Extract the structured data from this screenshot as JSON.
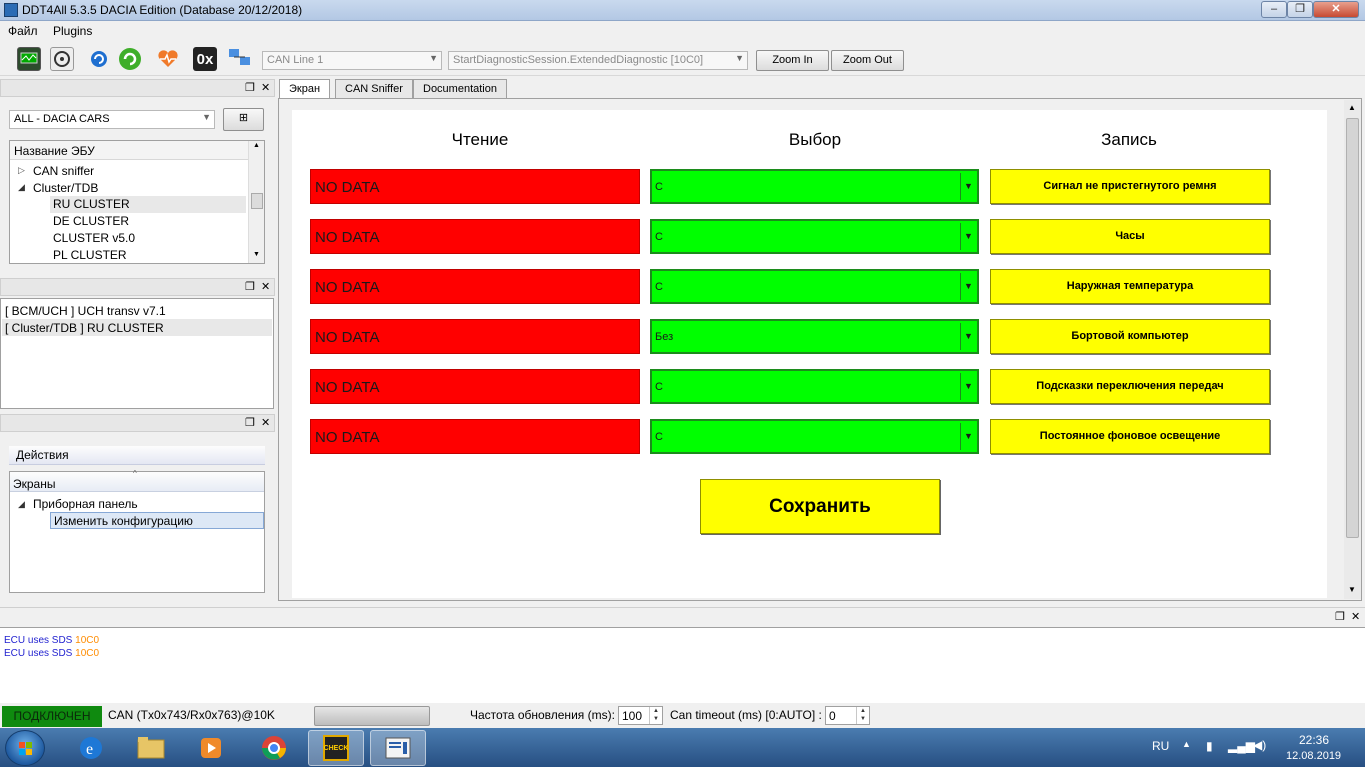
{
  "window": {
    "title": "DDT4All 5.3.5 DACIA Edition (Database 20/12/2018)",
    "controls": {
      "minimize": "–",
      "maximize": "❐",
      "close": "✕"
    }
  },
  "menu": [
    "Файл",
    "Plugins"
  ],
  "toolbar": {
    "icons": [
      "monitor-icon",
      "ecu-scan-icon",
      "refresh-icon",
      "connect-icon",
      "heart-add-icon",
      "hex-icon",
      "network-hand-icon"
    ],
    "hex_label": "0x",
    "can_line": "CAN Line 1",
    "session": "StartDiagnosticSession.ExtendedDiagnostic [10C0]",
    "zoom_in": "Zoom In",
    "zoom_out": "Zoom Out"
  },
  "ecu_panel": {
    "vehicle_filter": "ALL - DACIA CARS",
    "header": "Название ЭБУ",
    "tree": [
      {
        "label": "CAN sniffer",
        "expander": "▷"
      },
      {
        "label": "Cluster/TDB",
        "expander": "◢"
      },
      {
        "label": "RU CLUSTER",
        "selected": true
      },
      {
        "label": "DE CLUSTER"
      },
      {
        "label": "CLUSTER v5.0"
      },
      {
        "label": "PL CLUSTER"
      }
    ]
  },
  "open_ecus": [
    "[ BCM/UCH ] UCH transv v7.1",
    "[ Cluster/TDB ] RU CLUSTER"
  ],
  "actions_panel": {
    "tab": "Действия",
    "header": "Экраны",
    "group": "Приборная панель",
    "group_expander": "◢",
    "screen": "Изменить конфигурацию"
  },
  "tabs": [
    "Экран",
    "CAN Sniffer",
    "Documentation"
  ],
  "screen": {
    "headers": {
      "read": "Чтение",
      "select": "Выбор",
      "write": "Запись"
    },
    "rows": [
      {
        "reading": "NO DATA",
        "selection": "С",
        "action": "Сигнал не пристегнутого ремня"
      },
      {
        "reading": "NO DATA",
        "selection": "С",
        "action": "Часы"
      },
      {
        "reading": "NO DATA",
        "selection": "С",
        "action": "Наружная температура"
      },
      {
        "reading": "NO DATA",
        "selection": "Без",
        "action": "Бортовой компьютер"
      },
      {
        "reading": "NO DATA",
        "selection": "С",
        "action": "Подсказки переключения передач"
      },
      {
        "reading": "NO DATA",
        "selection": "С",
        "action": "Постоянное фоновое освещение"
      }
    ],
    "save": "Сохранить",
    "colors": {
      "reading_bg": "#ff0000",
      "select_bg": "#00ff00",
      "write_bg": "#ffff00"
    }
  },
  "log": [
    {
      "text": "ECU uses SDS ",
      "code": "10C0"
    },
    {
      "text": "ECU uses SDS ",
      "code": "10C0"
    }
  ],
  "status": {
    "connected": "ПОДКЛЮЧЕН",
    "can_info": "CAN (Tx0x743/Rx0x763)@10K",
    "refresh_label": "Частота обновления (ms):",
    "refresh_value": "100",
    "timeout_label": "Can timeout (ms) [0:AUTO] :",
    "timeout_value": "0"
  },
  "taskbar": {
    "apps": [
      "ie-icon",
      "explorer-icon",
      "media-player-icon",
      "chrome-icon",
      "check-app-icon",
      "ddt4all-icon"
    ],
    "check_label": "CHECK",
    "language": "RU",
    "time": "22:36",
    "date": "12.08.2019"
  }
}
